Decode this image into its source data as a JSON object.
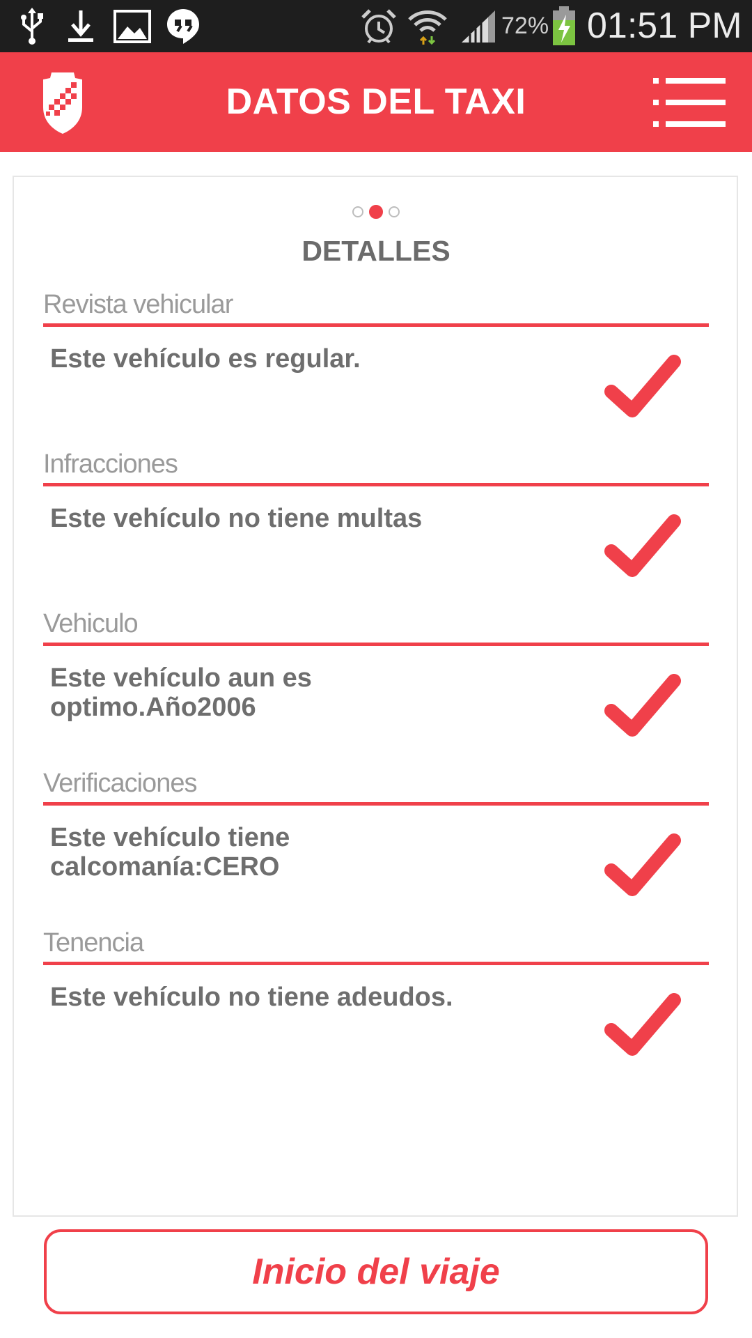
{
  "status_bar": {
    "icons": [
      "usb-icon",
      "download-icon",
      "image-icon",
      "hangouts-icon",
      "alarm-icon",
      "wifi-icon",
      "signal-icon",
      "battery-charging-icon"
    ],
    "battery": "72%",
    "time": "01:51 PM"
  },
  "header": {
    "title": "DATOS DEL TAXI",
    "logo": "shield-logo",
    "menu_icon": "list-menu-icon"
  },
  "pager": {
    "pages": 3,
    "active_page": 2
  },
  "details": {
    "title": "DETALLES",
    "items": [
      {
        "label": "Revista vehicular",
        "text": "Este vehículo es regular.",
        "status_icon": "check-icon"
      },
      {
        "label": "Infracciones",
        "text": "Este vehículo no tiene multas",
        "status_icon": "check-icon"
      },
      {
        "label": "Vehiculo",
        "text": "Este vehículo aun es optimo.Año2006",
        "status_icon": "check-icon"
      },
      {
        "label": "Verificaciones",
        "text": "Este vehículo tiene calcomanía:CERO",
        "status_icon": "check-icon"
      },
      {
        "label": "Tenencia",
        "text": "Este vehículo no tiene adeudos.",
        "status_icon": "check-icon"
      }
    ]
  },
  "footer": {
    "start_button": "Inicio del viaje"
  },
  "colors": {
    "accent": "#f0404a",
    "status_bar": "#1e1e1e",
    "text_dark": "#6e6e6e",
    "text_light": "#9a9a9a"
  }
}
